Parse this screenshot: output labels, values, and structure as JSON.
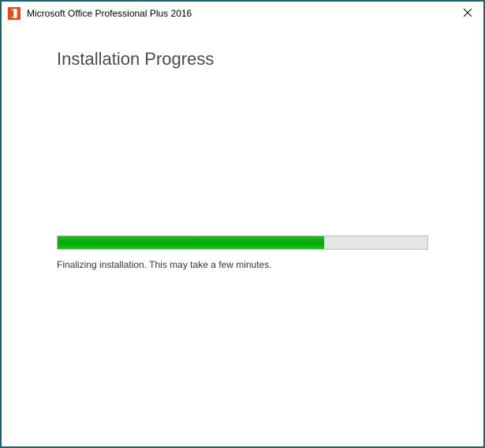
{
  "window": {
    "title": "Microsoft Office Professional Plus 2016"
  },
  "main": {
    "heading": "Installation Progress",
    "status": "Finalizing installation. This may take a few minutes.",
    "progress_percent": 72
  },
  "colors": {
    "border": "#0e6a72",
    "progress_fill": "#06a609",
    "icon_bg": "#e64a19"
  }
}
